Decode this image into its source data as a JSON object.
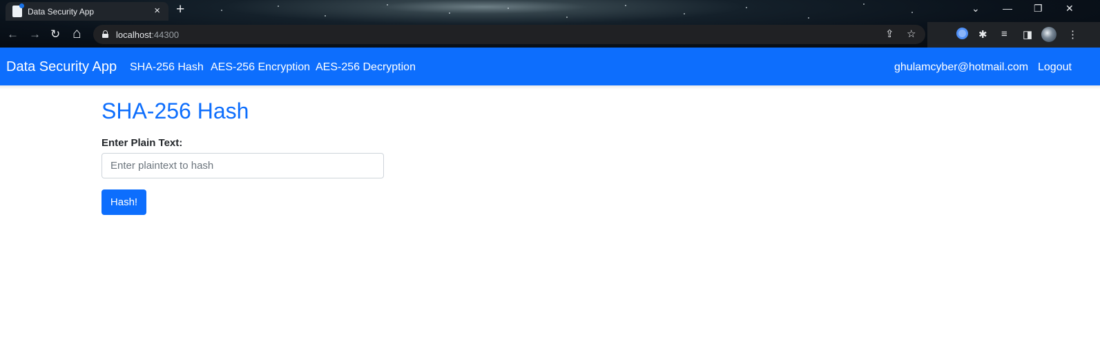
{
  "browser": {
    "tab_title": "Data Security App",
    "tab_close": "×",
    "new_tab": "+",
    "url_host": "localhost",
    "url_port": ":44300",
    "window_controls": {
      "tabs_menu": "⌄",
      "minimize": "—",
      "restore": "❐",
      "close": "✕"
    },
    "nav": {
      "back": "←",
      "forward": "→",
      "reload": "↻",
      "home": "⌂"
    },
    "omnibox_icons": {
      "share": "⇪",
      "bookmark": "☆"
    },
    "toolbar_icons": {
      "extensions": "✱",
      "media": "≡",
      "sidepanel": "◨",
      "menu": "⋮"
    }
  },
  "navbar": {
    "brand": "Data Security App",
    "links": [
      "SHA-256 Hash",
      "AES-256 Encryption",
      "AES-256 Decryption"
    ],
    "user_email": "ghulamcyber@hotmail.com",
    "logout": "Logout",
    "color": "#0d6efd"
  },
  "main": {
    "title": "SHA-256 Hash",
    "label": "Enter Plain Text:",
    "input_value": "",
    "input_placeholder": "Enter plaintext to hash",
    "button": "Hash!"
  }
}
